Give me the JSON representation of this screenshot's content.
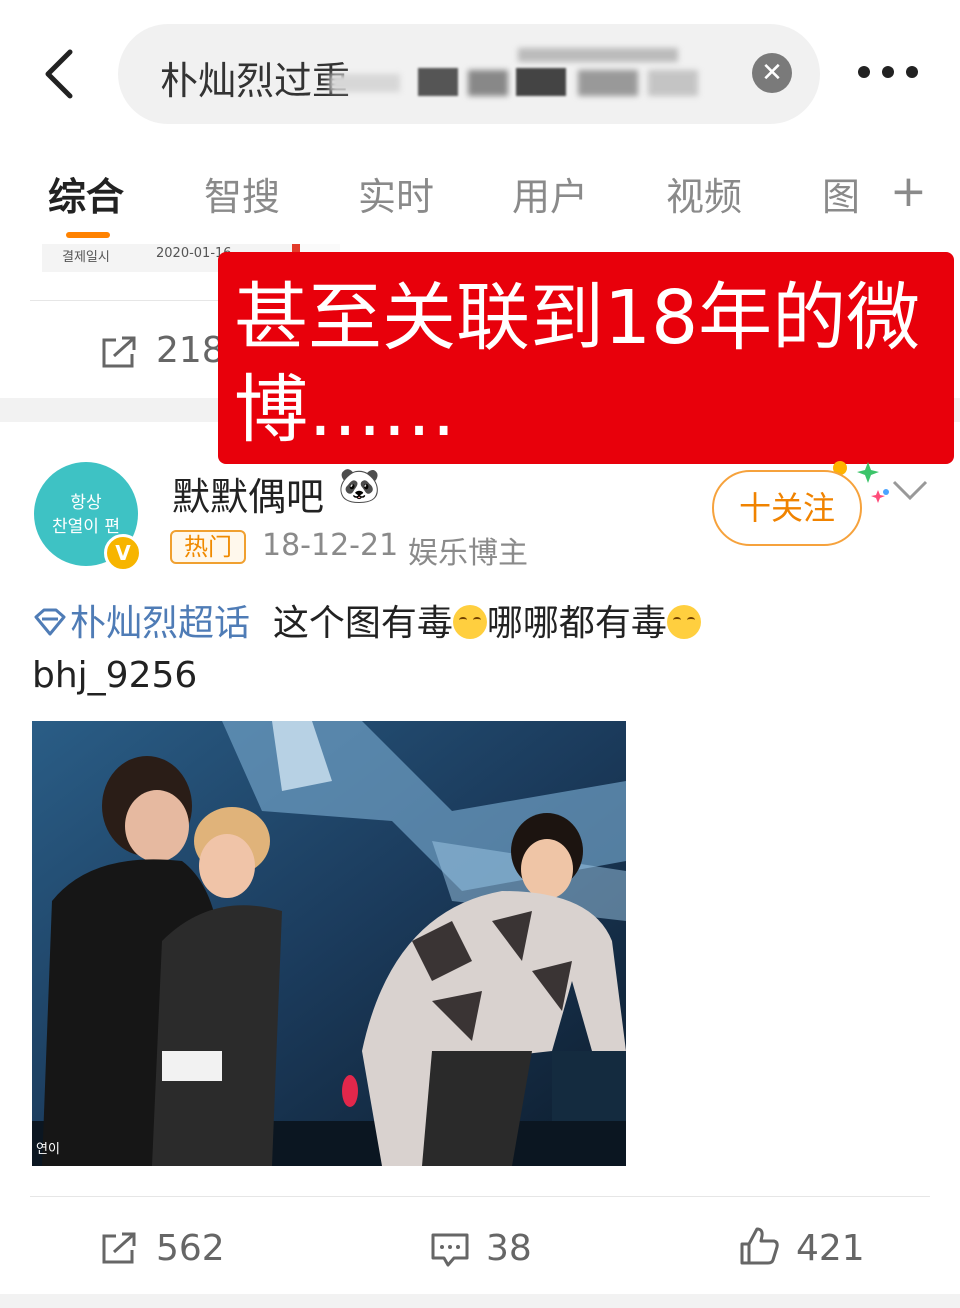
{
  "search": {
    "query_visible": "朴灿烈过重",
    "clear_icon": "clear-circle-icon"
  },
  "tabs": [
    {
      "label": "综合",
      "active": true
    },
    {
      "label": "智搜"
    },
    {
      "label": "实时"
    },
    {
      "label": "用户"
    },
    {
      "label": "视频"
    },
    {
      "label": "图"
    }
  ],
  "tab_add_label": "+",
  "previous_post": {
    "thumb_text_1": "결제일시",
    "thumb_text_2": "2020-01-16",
    "share_count": "218"
  },
  "banner": {
    "text": "甚至关联到18年的微博……",
    "color": "#e8000b"
  },
  "post": {
    "avatar_line1": "항상",
    "avatar_line2": "찬열이 편",
    "verified_mark": "V",
    "username": "默默偶吧",
    "username_emoji": "🐼",
    "hot_label": "热门",
    "date": "18-12-21",
    "role": "娱乐博主",
    "follow_label": "十关注",
    "topic": "朴灿烈超话",
    "text_part1": "这个图有毒",
    "text_part2": "哪哪都有毒",
    "text_line2": "bhj_9256",
    "watermark": "연이"
  },
  "actions": {
    "share_count": "562",
    "comment_count": "38",
    "like_count": "421"
  },
  "colors": {
    "accent": "#ff8200",
    "topic": "#4f7cb6",
    "follow": "#f08300"
  }
}
